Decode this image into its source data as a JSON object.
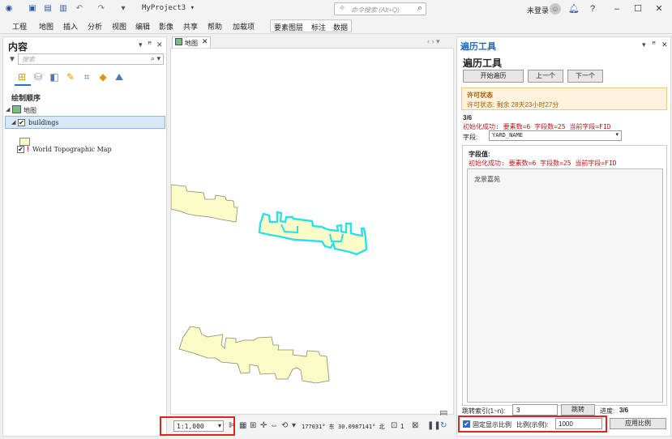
{
  "titlebar": {
    "project": "MyProject3",
    "search_placeholder": "命令搜索 (Alt+Q)",
    "signin": "未登录",
    "help": "?"
  },
  "menu": [
    "工程",
    "地图",
    "插入",
    "分析",
    "视图",
    "编辑",
    "影像",
    "共享",
    "帮助",
    "加载项"
  ],
  "context_tabs": [
    "要素图层",
    "标注",
    "数据"
  ],
  "contents": {
    "title": "内容",
    "search_placeholder": "搜索",
    "draw_order": "绘制顺序",
    "map": "地图",
    "layers": [
      {
        "name": "buildings",
        "checked": true,
        "selected": true
      },
      {
        "name": "World Topographic Map",
        "checked": true,
        "warning": true
      }
    ]
  },
  "map_view": {
    "tab_label": "地图",
    "scale": "1:1,000",
    "coords": "177031° 东 30.0987141° 北",
    "selected_count": "1"
  },
  "traversal": {
    "pane_title": "遍历工具",
    "heading": "遍历工具",
    "buttons": {
      "start": "开始遍历",
      "prev": "上一个",
      "next": "下一个"
    },
    "license": {
      "title": "许可状态",
      "status": "许可状态: 剩余 28天23小时27分"
    },
    "progress": "3/6",
    "init_msg": "初始化成功: 要素数=6 字段数=25 当前字段=FID",
    "field_label": "字段:",
    "field_value": "YARD_NAME",
    "field_values_title": "字段值:",
    "field_values_msg": "初始化成功: 要素数=6 字段数=25 当前字段=FID",
    "field_value_text": "龙景嘉苑",
    "jump_label": "跳转索引(1~n):",
    "jump_value": "3",
    "jump_button": "跳转",
    "progress_label": "进度:",
    "progress_value": "3/6",
    "fixed_scale_label": "固定显示比例",
    "fixed_scale_checked": true,
    "scale_label": "比例(示例):",
    "scale_value": "1000",
    "apply_scale_button": "应用比例"
  },
  "colors": {
    "building_fill": "#fbfbc8",
    "selection": "#28e0ee",
    "highlight": "#e02424",
    "accent": "#2a6fc9"
  }
}
